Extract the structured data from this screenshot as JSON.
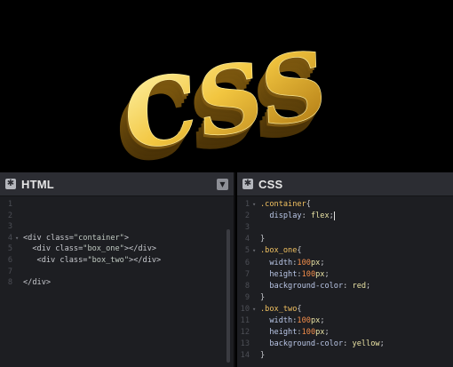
{
  "hero": {
    "text": "CSS",
    "colors": {
      "gold_light": "#fff3a0",
      "gold_mid": "#e0a820",
      "gold_dark": "#6b4a08",
      "background": "#000000"
    }
  },
  "html_panel": {
    "title": "HTML",
    "lines": [
      {
        "n": "1",
        "code": ""
      },
      {
        "n": "2",
        "code": ""
      },
      {
        "n": "3",
        "code": ""
      },
      {
        "n": "4",
        "code": "<div class=\"container\">"
      },
      {
        "n": "5",
        "code": "  <div class=\"box_one\"></div>"
      },
      {
        "n": "6",
        "code": "   <div class=\"box_two\"></div>"
      },
      {
        "n": "7",
        "code": ""
      },
      {
        "n": "8",
        "code": "</div>"
      }
    ]
  },
  "css_panel": {
    "title": "CSS",
    "lines": [
      {
        "n": "1",
        "code": ".container{"
      },
      {
        "n": "2",
        "code": "  display: flex;"
      },
      {
        "n": "3",
        "code": ""
      },
      {
        "n": "4",
        "code": "}"
      },
      {
        "n": "5",
        "code": ".box_one{"
      },
      {
        "n": "6",
        "code": "  width:100px;"
      },
      {
        "n": "7",
        "code": "  height:100px;"
      },
      {
        "n": "8",
        "code": "  background-color: red;"
      },
      {
        "n": "9",
        "code": "}"
      },
      {
        "n": "10",
        "code": ".box_two{"
      },
      {
        "n": "11",
        "code": "  width:100px;"
      },
      {
        "n": "12",
        "code": "  height:100px;"
      },
      {
        "n": "13",
        "code": "  background-color: yellow;"
      },
      {
        "n": "14",
        "code": "}"
      }
    ]
  }
}
